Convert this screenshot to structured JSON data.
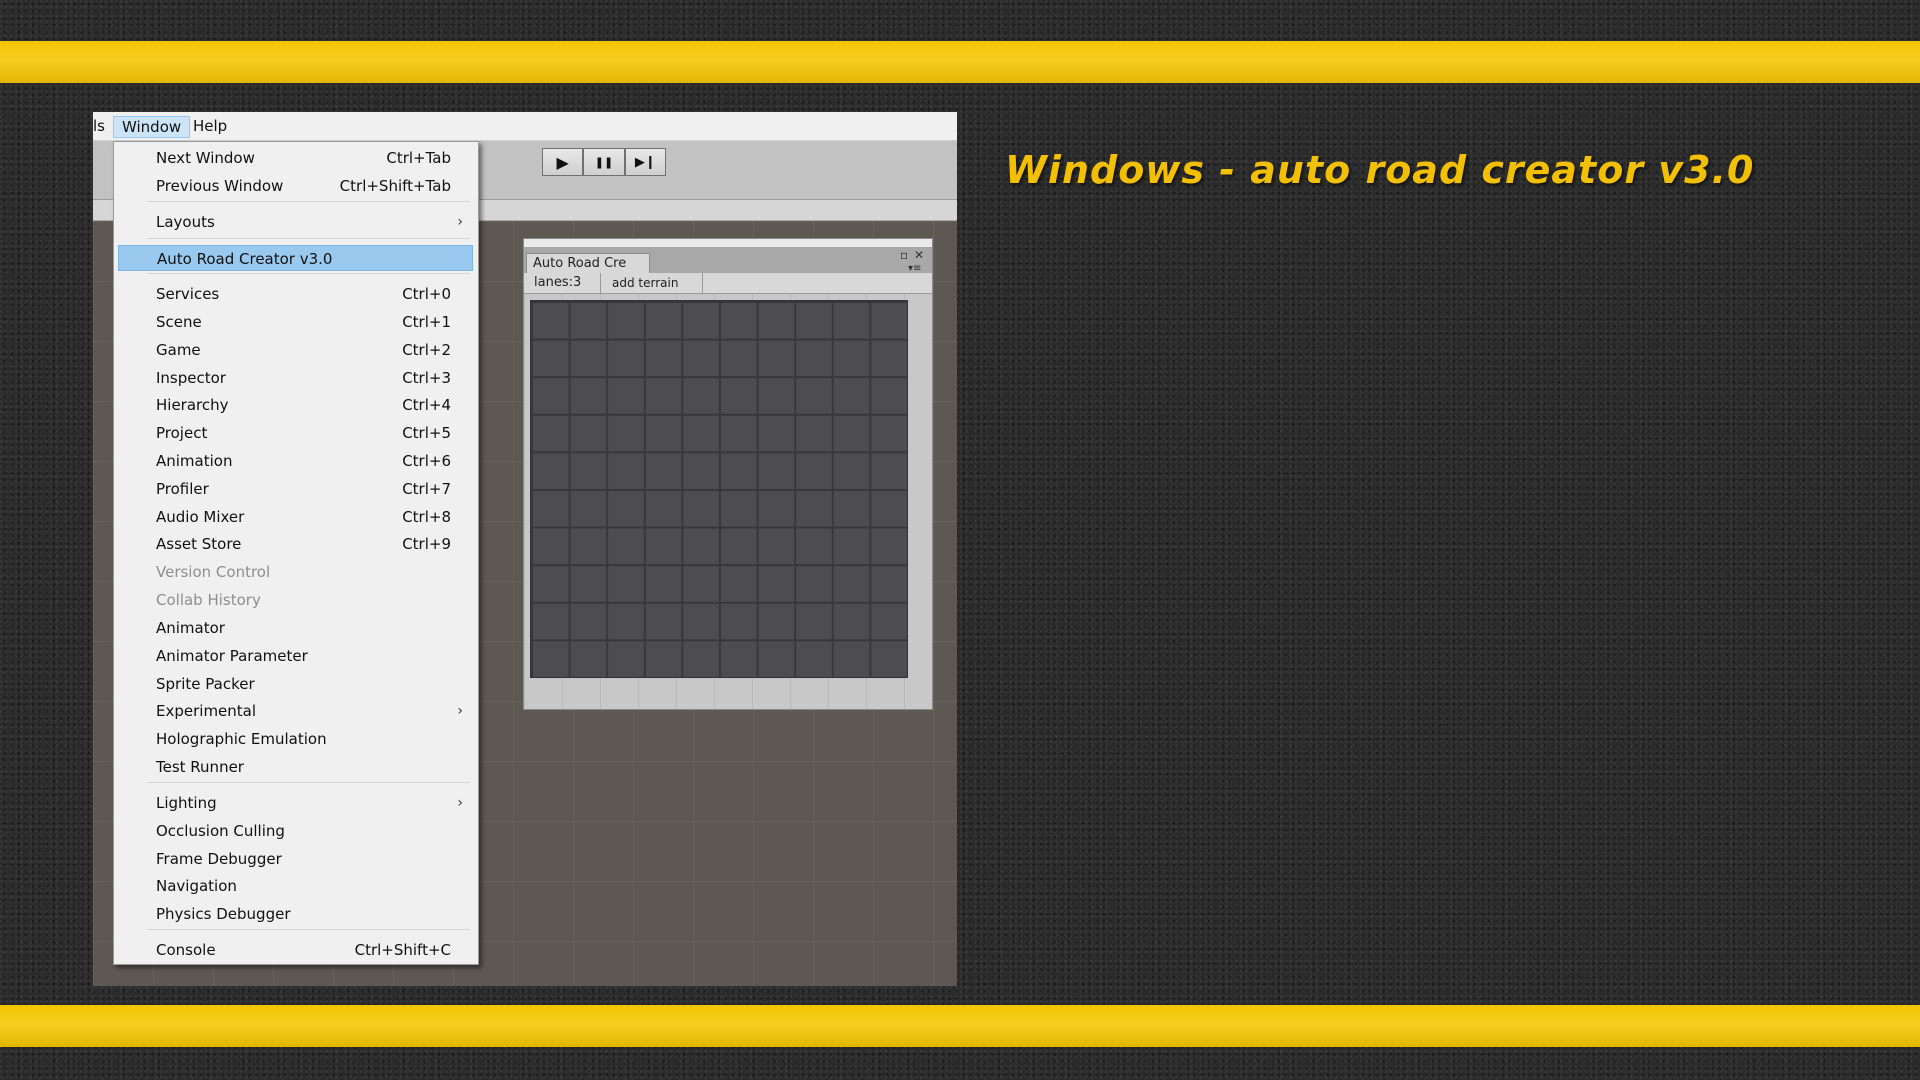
{
  "promo": {
    "title": "Windows - auto road creator v3.0"
  },
  "menubar": {
    "tools_fragment": "ls",
    "window": "Window",
    "help": "Help"
  },
  "toolbar": {
    "play": "▶",
    "pause": "❚❚",
    "step": "▶❙"
  },
  "auto_road_window": {
    "tab_title": "Auto Road Cre",
    "lanes_label": "lanes:3",
    "add_terrain_label": "add terrain",
    "maximize_glyph": "▫",
    "close_glyph": "✕",
    "menu_glyph": "▾≡"
  },
  "window_menu": {
    "items": [
      {
        "label": "Next Window",
        "shortcut": "Ctrl+Tab"
      },
      {
        "label": "Previous Window",
        "shortcut": "Ctrl+Shift+Tab"
      },
      {
        "label": "Layouts",
        "submenu": "›"
      },
      {
        "label": "Auto Road Creator v3.0",
        "highlighted": true
      },
      {
        "label": "Services",
        "shortcut": "Ctrl+0"
      },
      {
        "label": "Scene",
        "shortcut": "Ctrl+1"
      },
      {
        "label": "Game",
        "shortcut": "Ctrl+2"
      },
      {
        "label": "Inspector",
        "shortcut": "Ctrl+3"
      },
      {
        "label": "Hierarchy",
        "shortcut": "Ctrl+4"
      },
      {
        "label": "Project",
        "shortcut": "Ctrl+5"
      },
      {
        "label": "Animation",
        "shortcut": "Ctrl+6"
      },
      {
        "label": "Profiler",
        "shortcut": "Ctrl+7"
      },
      {
        "label": "Audio Mixer",
        "shortcut": "Ctrl+8"
      },
      {
        "label": "Asset Store",
        "shortcut": "Ctrl+9"
      },
      {
        "label": "Version Control",
        "disabled": true
      },
      {
        "label": "Collab History",
        "disabled": true
      },
      {
        "label": "Animator"
      },
      {
        "label": "Animator Parameter"
      },
      {
        "label": "Sprite Packer"
      },
      {
        "label": "Experimental",
        "submenu": "›"
      },
      {
        "label": "Holographic Emulation"
      },
      {
        "label": "Test Runner"
      },
      {
        "label": "Lighting",
        "submenu": "›"
      },
      {
        "label": "Occlusion Culling"
      },
      {
        "label": "Frame Debugger"
      },
      {
        "label": "Navigation"
      },
      {
        "label": "Physics Debugger"
      },
      {
        "label": "Console",
        "shortcut": "Ctrl+Shift+C"
      }
    ]
  },
  "colors": {
    "stripe": "#f2c400",
    "title": "#f2c000",
    "menu_highlight": "#99c9ef",
    "asphalt": "#2b2b2b"
  }
}
